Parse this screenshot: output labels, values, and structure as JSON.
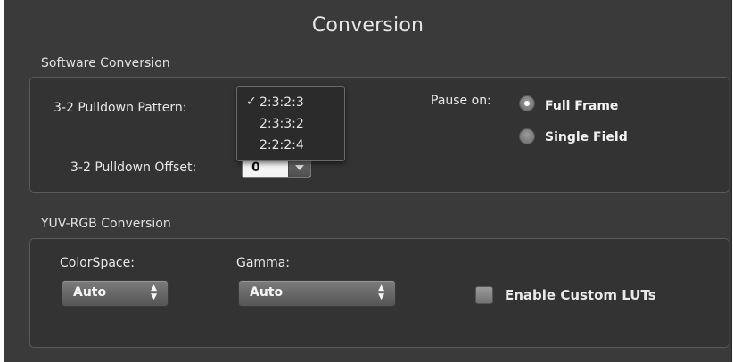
{
  "title": "Conversion",
  "software_conversion": {
    "section_label": "Software Conversion",
    "pulldown_pattern": {
      "label": "3-2 Pulldown Pattern:",
      "options": [
        "2:3:2:3",
        "2:3:3:2",
        "2:2:2:4"
      ],
      "selected": "2:3:2:3",
      "check_glyph": "✓"
    },
    "pulldown_offset": {
      "label": "3-2 Pulldown Offset:",
      "value": "0"
    },
    "pause_on": {
      "label": "Pause on:",
      "options": [
        "Full Frame",
        "Single Field"
      ],
      "selected": "Full Frame"
    }
  },
  "yuv_rgb_conversion": {
    "section_label": "YUV-RGB Conversion",
    "colorspace": {
      "label": "ColorSpace:",
      "value": "Auto"
    },
    "gamma": {
      "label": "Gamma:",
      "value": "Auto"
    },
    "custom_luts": {
      "label": "Enable Custom LUTs",
      "checked": false
    }
  }
}
